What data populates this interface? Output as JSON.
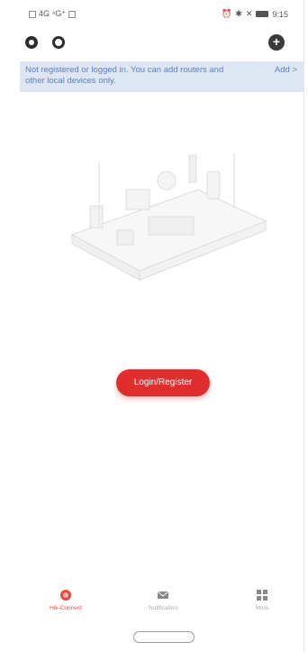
{
  "status_bar": {
    "left_text": "4G ⁴G⁺",
    "time": "9:15"
  },
  "banner": {
    "message": "Not registered or logged in. You can add routers and other local devices only.",
    "action": "Add >"
  },
  "login_button": {
    "label": "Login/Register"
  },
  "bottom_nav": [
    {
      "label": "Hik-Connect",
      "icon": "camera-icon",
      "active": true
    },
    {
      "label": "Notification",
      "icon": "mail-icon",
      "active": false
    },
    {
      "label": "More",
      "icon": "grid-icon",
      "active": false
    }
  ],
  "colors": {
    "accent": "#e02d2d",
    "banner_bg": "#dfe6f3",
    "banner_text": "#5a7fc0"
  }
}
